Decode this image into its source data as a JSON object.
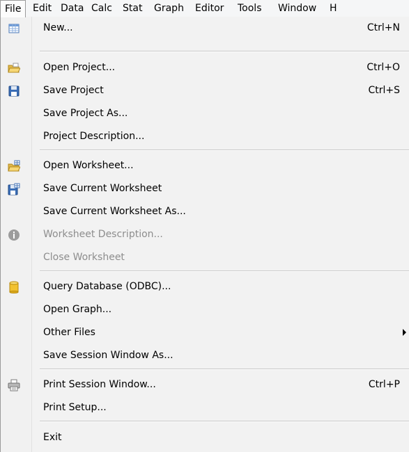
{
  "menubar": {
    "items": [
      {
        "label": "File"
      },
      {
        "label": "Edit"
      },
      {
        "label": "Data"
      },
      {
        "label": "Calc"
      },
      {
        "label": "Stat"
      },
      {
        "label": "Graph"
      },
      {
        "label": "Editor"
      },
      {
        "label": "Tools"
      },
      {
        "label": "Window"
      },
      {
        "label": "H"
      }
    ]
  },
  "file_menu": {
    "items": [
      {
        "label": "New...",
        "shortcut": "Ctrl+N",
        "icon": "new-worksheet-icon",
        "enabled": true
      },
      {
        "label": "Open Project...",
        "shortcut": "Ctrl+O",
        "icon": "open-folder-icon",
        "enabled": true
      },
      {
        "label": "Save Project",
        "shortcut": "Ctrl+S",
        "icon": "floppy-disk-icon",
        "enabled": true
      },
      {
        "label": "Save Project As...",
        "enabled": true
      },
      {
        "label": "Project Description...",
        "enabled": true
      },
      {
        "label": "Open Worksheet...",
        "icon": "open-worksheet-folder-icon",
        "enabled": true
      },
      {
        "label": "Save Current Worksheet",
        "icon": "save-worksheet-icon",
        "enabled": true
      },
      {
        "label": "Save Current Worksheet As...",
        "enabled": true
      },
      {
        "label": "Worksheet Description...",
        "icon": "info-icon",
        "enabled": false
      },
      {
        "label": "Close Worksheet",
        "enabled": false
      },
      {
        "label": "Query Database (ODBC)...",
        "icon": "database-icon",
        "enabled": true
      },
      {
        "label": "Open Graph...",
        "enabled": true
      },
      {
        "label": "Other Files",
        "submenu": true,
        "enabled": true
      },
      {
        "label": "Save Session Window As...",
        "enabled": true
      },
      {
        "label": "Print Session Window...",
        "shortcut": "Ctrl+P",
        "icon": "printer-icon",
        "enabled": true
      },
      {
        "label": "Print Setup...",
        "enabled": true
      },
      {
        "label": "Exit",
        "enabled": true
      }
    ]
  },
  "colors": {
    "menu_background": "#f2f2f2",
    "disabled_text": "#8d8d8d",
    "separator": "#c8c8c8"
  }
}
